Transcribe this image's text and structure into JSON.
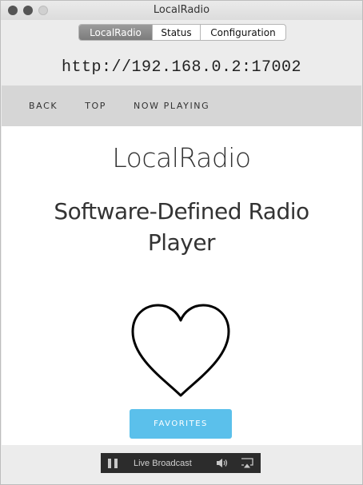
{
  "window": {
    "title": "LocalRadio"
  },
  "tabs": [
    {
      "label": "LocalRadio",
      "active": true
    },
    {
      "label": "Status",
      "active": false
    },
    {
      "label": "Configuration",
      "active": false
    }
  ],
  "url": "http://192.168.0.2:17002",
  "nav": {
    "back": "BACK",
    "top": "TOP",
    "now_playing": "NOW PLAYING"
  },
  "main": {
    "title": "LocalRadio",
    "subtitle": "Software-Defined Radio Player",
    "favorites_label": "FAVORITES",
    "icon": "heart-icon"
  },
  "player": {
    "status_text": "Live Broadcast",
    "icons": [
      "pause-icon",
      "volume-icon",
      "airplay-icon"
    ]
  },
  "colors": {
    "accent": "#5bc0eb",
    "navbar": "#d6d6d6",
    "player_bg": "#2c2c2c"
  }
}
